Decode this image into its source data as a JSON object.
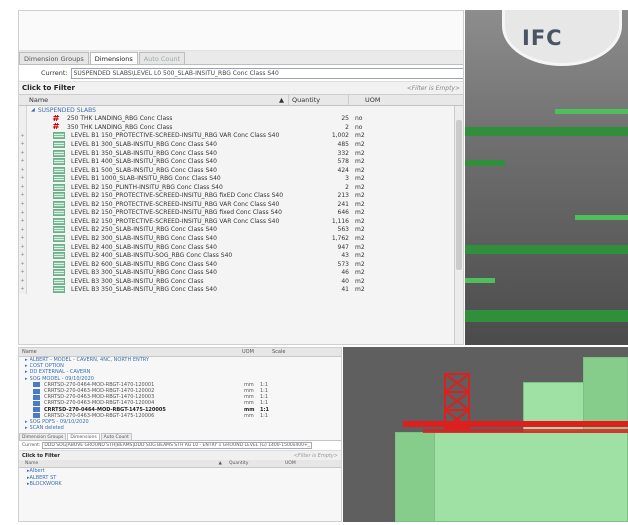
{
  "main_panel": {
    "tabs": [
      {
        "label": "Dimension Groups",
        "active": false
      },
      {
        "label": "Dimensions",
        "active": true
      },
      {
        "label": "Auto Count",
        "active": false
      }
    ],
    "current_label": "Current:",
    "current_value": "SUSPENDED SLABS\\LEVEL L0 500_SLAB-INSITU_RBG Conc Class S40",
    "filter_title": "Click to Filter",
    "filter_hint": "<Filter is Empty>",
    "columns": {
      "name": "Name",
      "quantity": "Quantity",
      "uom": "UOM"
    },
    "group": "SUSPENDED SLABS",
    "rows": [
      {
        "icon": "hash",
        "name": "250 THK LANDING_RBG Conc Class",
        "quantity": "25",
        "uom": "no"
      },
      {
        "icon": "hash",
        "name": "350 THK LANDING_RBG Conc Class",
        "quantity": "2",
        "uom": "no"
      },
      {
        "icon": "slab",
        "name": "LEVEL B1 150_PROTECTIVE-SCREED-INSITU_RBG VAR Conc Class S40",
        "quantity": "1,002",
        "uom": "m2"
      },
      {
        "icon": "slab",
        "name": "LEVEL B1 300_SLAB-INSITU_RBG Conc Class S40",
        "quantity": "485",
        "uom": "m2"
      },
      {
        "icon": "slab",
        "name": "LEVEL B1 350_SLAB-INSITU_RBG Conc Class S40",
        "quantity": "332",
        "uom": "m2"
      },
      {
        "icon": "slab",
        "name": "LEVEL B1 400_SLAB-INSITU_RBG Conc Class S40",
        "quantity": "578",
        "uom": "m2"
      },
      {
        "icon": "slab",
        "name": "LEVEL B1 500_SLAB-INSITU_RBG Conc Class S40",
        "quantity": "424",
        "uom": "m2"
      },
      {
        "icon": "slab",
        "name": "LEVEL B1 1000_SLAB-INSITU_RBG Conc Class S40",
        "quantity": "3",
        "uom": "m2"
      },
      {
        "icon": "slab",
        "name": "LEVEL B2 150_PLINTH-INSITU_RBG Conc Class S40",
        "quantity": "2",
        "uom": "m2"
      },
      {
        "icon": "slab",
        "name": "LEVEL B2 150_PROTECTIVE-SCREED-INSITU_RBG fixED Conc Class S40",
        "quantity": "213",
        "uom": "m2"
      },
      {
        "icon": "slab",
        "name": "LEVEL B2 150_PROTECTIVE-SCREED-INSITU_RBG VAR Conc Class S40",
        "quantity": "241",
        "uom": "m2"
      },
      {
        "icon": "slab",
        "name": "LEVEL B2 150_PROTECTIVE-SCREED-INSITU_RBG fixed Conc Class S40",
        "quantity": "646",
        "uom": "m2"
      },
      {
        "icon": "slab",
        "name": "LEVEL B2 150_PROTECTIVE-SCREED-INSITU_RBG VAR Conc Class S40",
        "quantity": "1,116",
        "uom": "m2"
      },
      {
        "icon": "slab",
        "name": "LEVEL B2 250_SLAB-INSITU_RBG Conc Class S40",
        "quantity": "563",
        "uom": "m2"
      },
      {
        "icon": "slab",
        "name": "LEVEL B2 300_SLAB-INSITU_RBG Conc Class S40",
        "quantity": "1,762",
        "uom": "m2"
      },
      {
        "icon": "slab",
        "name": "LEVEL B2 400_SLAB-INSITU_RBG Conc Class S40",
        "quantity": "947",
        "uom": "m2"
      },
      {
        "icon": "slab",
        "name": "LEVEL B2 400_SLAB-INSITU-SOG_RBG Conc Class S40",
        "quantity": "43",
        "uom": "m2"
      },
      {
        "icon": "slab",
        "name": "LEVEL B2 600_SLAB-INSITU_RBG Conc Class S40",
        "quantity": "573",
        "uom": "m2"
      },
      {
        "icon": "slab",
        "name": "LEVEL B3 300_SLAB-INSITU_RBG Conc Class S40",
        "quantity": "46",
        "uom": "m2"
      },
      {
        "icon": "slab",
        "name": "LEVEL B3 300_SLAB-INSITU_RBG Conc Class",
        "quantity": "40",
        "uom": "m2"
      },
      {
        "icon": "slab",
        "name": "LEVEL B3 350_SLAB-INSITU_RBG Conc Class S40",
        "quantity": "41",
        "uom": "m2"
      }
    ]
  },
  "viewport": {
    "logo": "IFC"
  },
  "lower_panel": {
    "columns": {
      "name": "Name",
      "uom": "UOM",
      "scale": "Scale"
    },
    "groups_top": [
      "ALBERT - MODEL - CAVERN, 4NC, NORTH ENTRY",
      "COST OPTION",
      "DD EXTERNAL - CAVERN"
    ],
    "active_group": "SOG MODEL - 09/10/2020",
    "items": [
      {
        "name": "CRRTSD-270-0464-MOD-RBGT-1470-120001",
        "uom": "mm",
        "scale": "1:1",
        "bold": false
      },
      {
        "name": "CRRTSD-270-0463-MOD-RBGT-1470-120002",
        "uom": "mm",
        "scale": "1:1",
        "bold": false
      },
      {
        "name": "CRRTSD-270-0463-MOD-RBGT-1470-120003",
        "uom": "mm",
        "scale": "1:1",
        "bold": false
      },
      {
        "name": "CRRTSD-270-0463-MOD-RBGT-1470-120004",
        "uom": "mm",
        "scale": "1:1",
        "bold": false
      },
      {
        "name": "CRRTSD-270-0464-MOD-RBGT-1475-120005",
        "uom": "mm",
        "scale": "1:1",
        "bold": true
      },
      {
        "name": "CRRTSD-270-0463-MOD-RBGT-1475-120006",
        "uom": "mm",
        "scale": "1:1",
        "bold": false
      }
    ],
    "groups_bottom": [
      "SOG PDFS - 09/10/2020",
      "SCAN deleted"
    ],
    "tabs": [
      "Dimension Groups",
      "Dimensions",
      "Auto Count"
    ],
    "current_label": "Current:",
    "current_value": "DDD SOG|ABOVE GROUND STH|BEAMS|DDD SOG BEAMS STH AG L0 - ENTRY 1 GROUND LEVEL (G) 1400-1500x400+_TAPER",
    "filter_title": "Click to Filter",
    "filter_hint": "<Filter is Empty>",
    "grid_columns": {
      "name": "Name",
      "quantity": "Quantity",
      "uom": "UOM"
    },
    "tree": [
      "Albert",
      "ALBERT ST",
      "BLOCKWORK"
    ]
  }
}
